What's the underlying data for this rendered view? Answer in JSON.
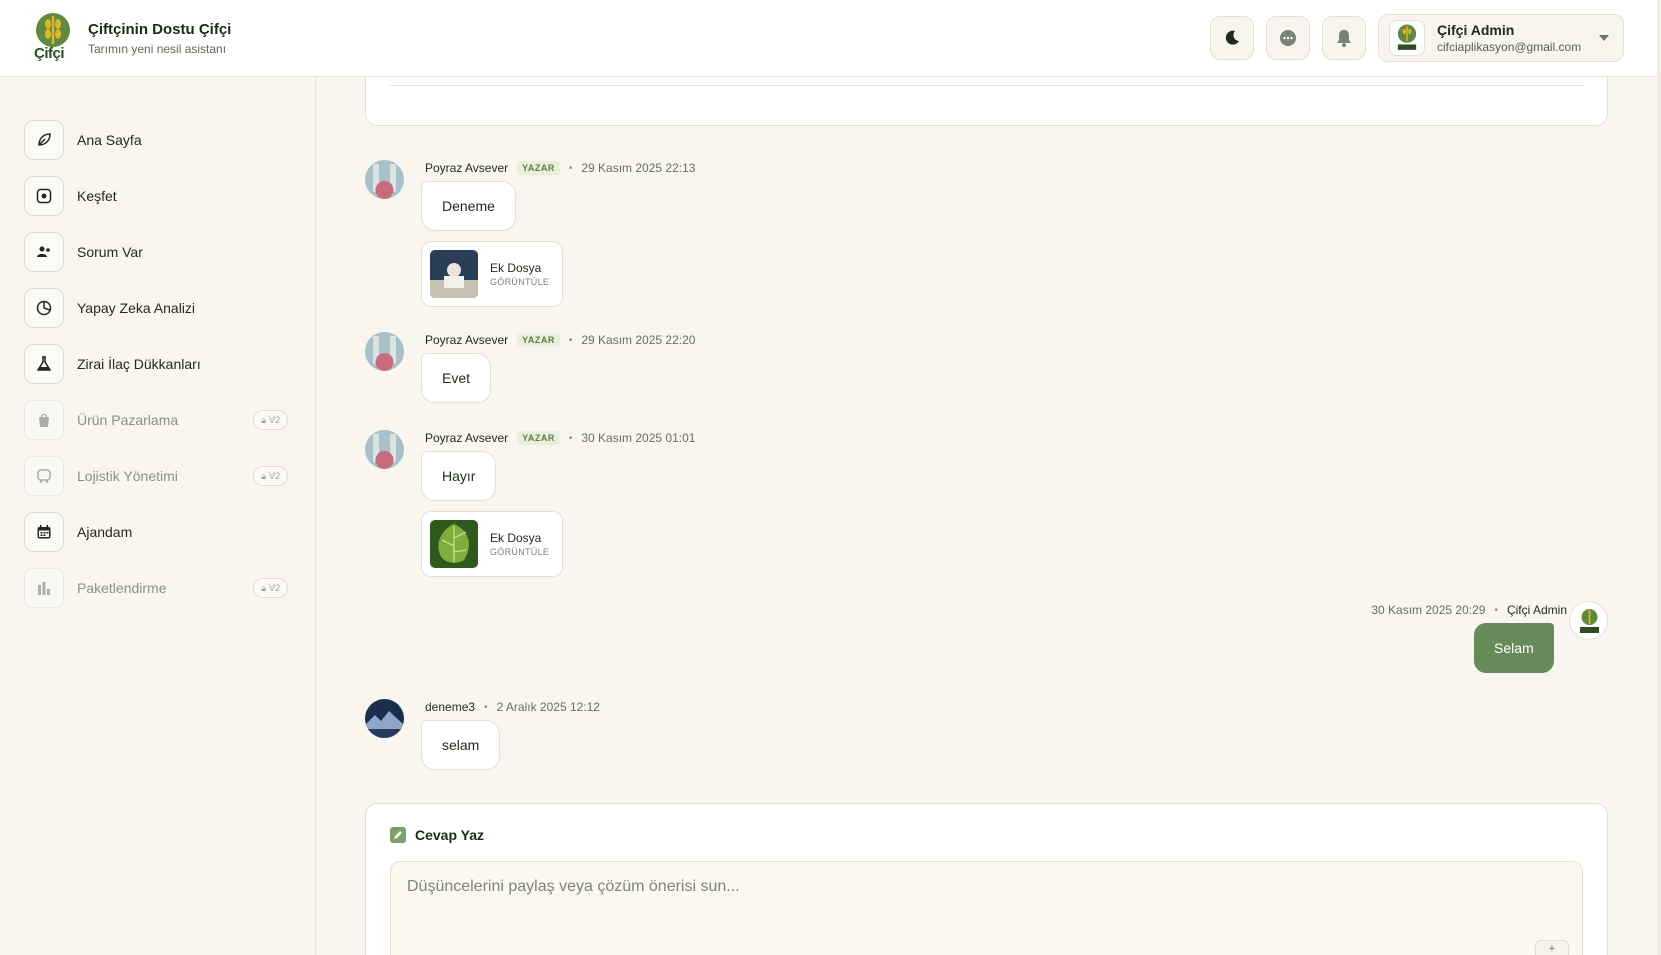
{
  "header": {
    "brand_title": "Çiftçinin Dostu Çifçi",
    "brand_subtitle": "Tarımın yeni nesil asistanı",
    "logo_text": "Çifçi",
    "user_name": "Çifçi Admin",
    "user_email": "cifciaplikasyon@gmail.com"
  },
  "sidebar": {
    "items": [
      {
        "label": "Ana Sayfa",
        "icon": "leaf-icon",
        "locked": false
      },
      {
        "label": "Keşfet",
        "icon": "compass-icon",
        "locked": false
      },
      {
        "label": "Sorum Var",
        "icon": "users-icon",
        "locked": false
      },
      {
        "label": "Yapay Zeka Analizi",
        "icon": "pie-chart-icon",
        "locked": false
      },
      {
        "label": "Zirai İlaç Dükkanları",
        "icon": "flask-icon",
        "locked": false
      },
      {
        "label": "Ürün Pazarlama",
        "icon": "shopping-bag-icon",
        "locked": true,
        "badge": "V2"
      },
      {
        "label": "Lojistik Yönetimi",
        "icon": "truck-icon",
        "locked": true,
        "badge": "V2"
      },
      {
        "label": "Ajandam",
        "icon": "calendar-icon",
        "locked": false
      },
      {
        "label": "Paketlendirme",
        "icon": "bar-chart-icon",
        "locked": true,
        "badge": "V2"
      }
    ]
  },
  "messages": [
    {
      "author": "Poyraz Avsever",
      "role": "YAZAR",
      "time": "29 Kasım 2025 22:13",
      "text": "Deneme",
      "attachment": {
        "title": "Ek Dosya",
        "action": "GÖRÜNTÜLE"
      }
    },
    {
      "author": "Poyraz Avsever",
      "role": "YAZAR",
      "time": "29 Kasım 2025 22:20",
      "text": "Evet"
    },
    {
      "author": "Poyraz Avsever",
      "role": "YAZAR",
      "time": "30 Kasım 2025 01:01",
      "text": "Hayır",
      "attachment": {
        "title": "Ek Dosya",
        "action": "GÖRÜNTÜLE"
      }
    },
    {
      "author": "Çifçi Admin",
      "time": "30 Kasım 2025 20:29",
      "text": "Selam",
      "own": true
    },
    {
      "author": "deneme3",
      "time": "2 Aralık 2025 12:12",
      "text": "selam"
    }
  ],
  "reply": {
    "title": "Cevap Yaz",
    "placeholder": "Düşüncelerini paylaş veya çözüm önerisi sun..."
  },
  "colors": {
    "accent": "#668a58",
    "background": "#f8f6ef",
    "badge_bg": "#e9eedd"
  }
}
